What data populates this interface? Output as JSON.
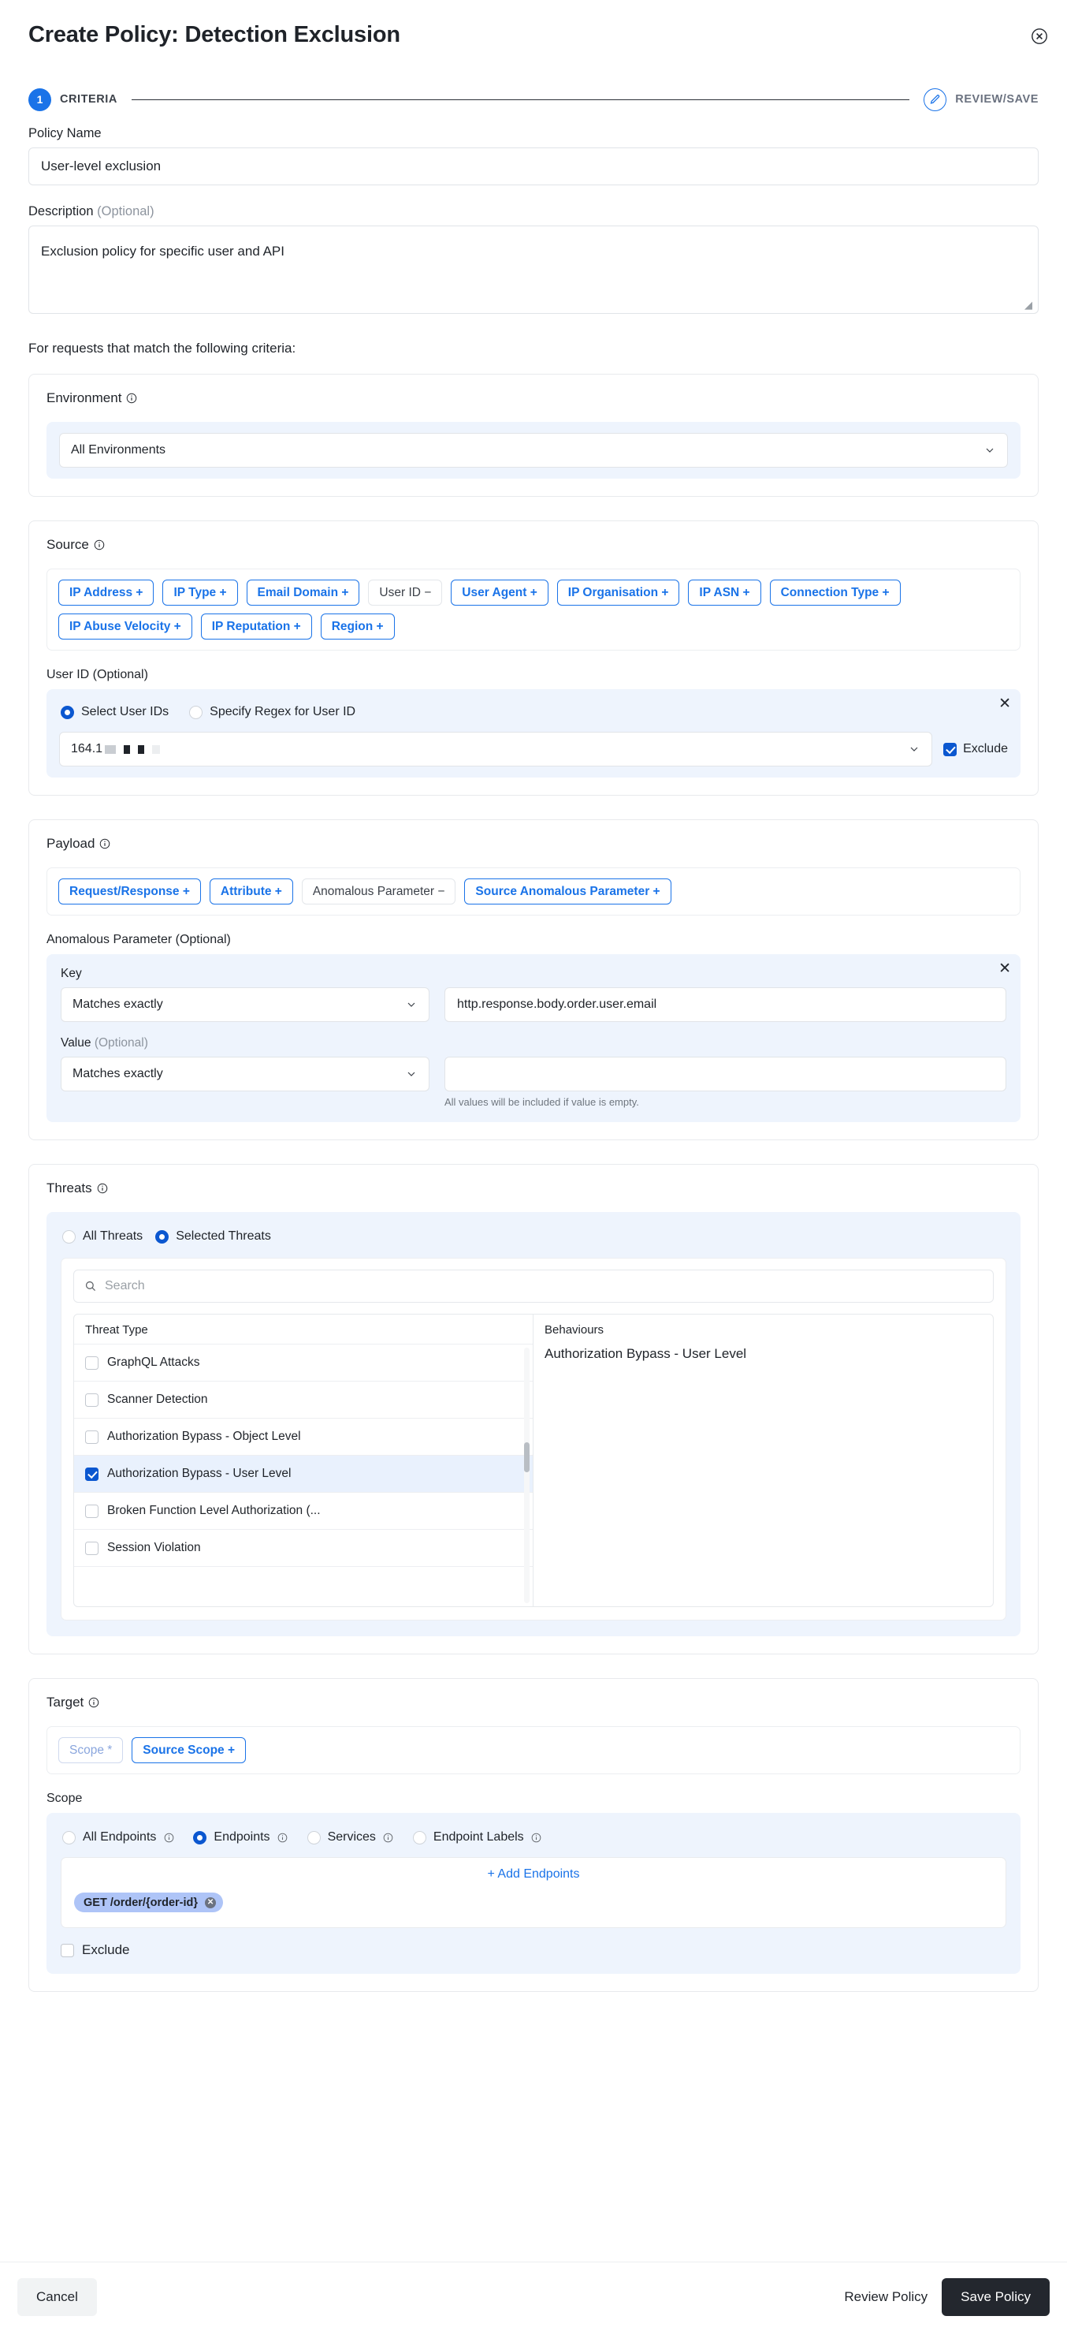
{
  "header": {
    "title": "Create Policy: Detection Exclusion",
    "close_icon": "close-circle-icon"
  },
  "stepper": {
    "step1_number": "1",
    "step1_label": "CRITERIA",
    "step2_icon": "pencil-icon",
    "step2_label": "REVIEW/SAVE"
  },
  "form": {
    "policy_name_label": "Policy Name",
    "policy_name_value": "User-level exclusion",
    "description_label": "Description",
    "description_optional": "(Optional)",
    "description_value": "Exclusion policy for specific user and API",
    "criteria_intro": "For requests that match the following criteria:"
  },
  "environment": {
    "title": "Environment",
    "info_icon": "info-icon",
    "selected": "All Environments",
    "chevron_icon": "chevron-down-icon"
  },
  "source": {
    "title": "Source",
    "info_icon": "info-icon",
    "chips": [
      {
        "label": "IP Address +",
        "state": "active"
      },
      {
        "label": "IP Type +",
        "state": "active"
      },
      {
        "label": "Email Domain +",
        "state": "active"
      },
      {
        "label": "User ID −",
        "state": "inactive"
      },
      {
        "label": "User Agent +",
        "state": "active"
      },
      {
        "label": "IP Organisation +",
        "state": "active"
      },
      {
        "label": "IP ASN +",
        "state": "active"
      },
      {
        "label": "Connection Type +",
        "state": "active"
      },
      {
        "label": "IP Abuse Velocity +",
        "state": "active"
      },
      {
        "label": "IP Reputation +",
        "state": "active"
      },
      {
        "label": "Region +",
        "state": "active"
      }
    ],
    "userid_label": "User ID (Optional)",
    "radio_select_ids": "Select User IDs",
    "radio_specify_regex": "Specify Regex for User ID",
    "userid_value_visible": "164.1",
    "exclude_label": "Exclude",
    "close_label": "✕"
  },
  "payload": {
    "title": "Payload",
    "info_icon": "info-icon",
    "chips": [
      {
        "label": "Request/Response +",
        "state": "active"
      },
      {
        "label": "Attribute +",
        "state": "active"
      },
      {
        "label": "Anomalous Parameter −",
        "state": "inactive"
      },
      {
        "label": "Source Anomalous Parameter +",
        "state": "active"
      }
    ],
    "param_label": "Anomalous Parameter (Optional)",
    "key_label": "Key",
    "key_operator": "Matches exactly",
    "key_value": "http.response.body.order.user.email",
    "value_label": "Value",
    "value_optional": "(Optional)",
    "value_operator": "Matches exactly",
    "value_value": "",
    "value_hint": "All values will be included if value is empty.",
    "close_label": "✕"
  },
  "threats": {
    "title": "Threats",
    "info_icon": "info-icon",
    "radio_all": "All Threats",
    "radio_selected": "Selected Threats",
    "search_placeholder": "Search",
    "search_icon": "search-icon",
    "threat_type_header": "Threat Type",
    "behaviours_header": "Behaviours",
    "threat_rows": [
      {
        "label": "GraphQL Attacks",
        "checked": false
      },
      {
        "label": "Scanner Detection",
        "checked": false
      },
      {
        "label": "Authorization Bypass - Object Level",
        "checked": false
      },
      {
        "label": "Authorization Bypass - User Level",
        "checked": true
      },
      {
        "label": "Broken Function Level Authorization (...",
        "checked": false
      },
      {
        "label": "Session Violation",
        "checked": false
      }
    ],
    "behaviours": [
      "Authorization Bypass - User Level"
    ]
  },
  "target": {
    "title": "Target",
    "info_icon": "info-icon",
    "chips": [
      {
        "label": "Scope *",
        "state": "dim"
      },
      {
        "label": "Source Scope +",
        "state": "active"
      }
    ],
    "scope_label": "Scope",
    "scope_options": [
      {
        "label": "All Endpoints",
        "checked": false
      },
      {
        "label": "Endpoints",
        "checked": true
      },
      {
        "label": "Services",
        "checked": false
      },
      {
        "label": "Endpoint Labels",
        "checked": false
      }
    ],
    "add_endpoints": "+ Add Endpoints",
    "endpoint_tags": [
      {
        "label": "GET /order/{order-id}"
      }
    ],
    "exclude_label": "Exclude",
    "exclude_checked": false
  },
  "footer": {
    "cancel": "Cancel",
    "review": "Review Policy",
    "save": "Save Policy"
  },
  "colors": {
    "accent": "#1a73e8",
    "accent_dark": "#0b57d0",
    "panel_blue": "#eef4fd",
    "tag_blue": "#aec4f7",
    "dark": "#23272e"
  }
}
